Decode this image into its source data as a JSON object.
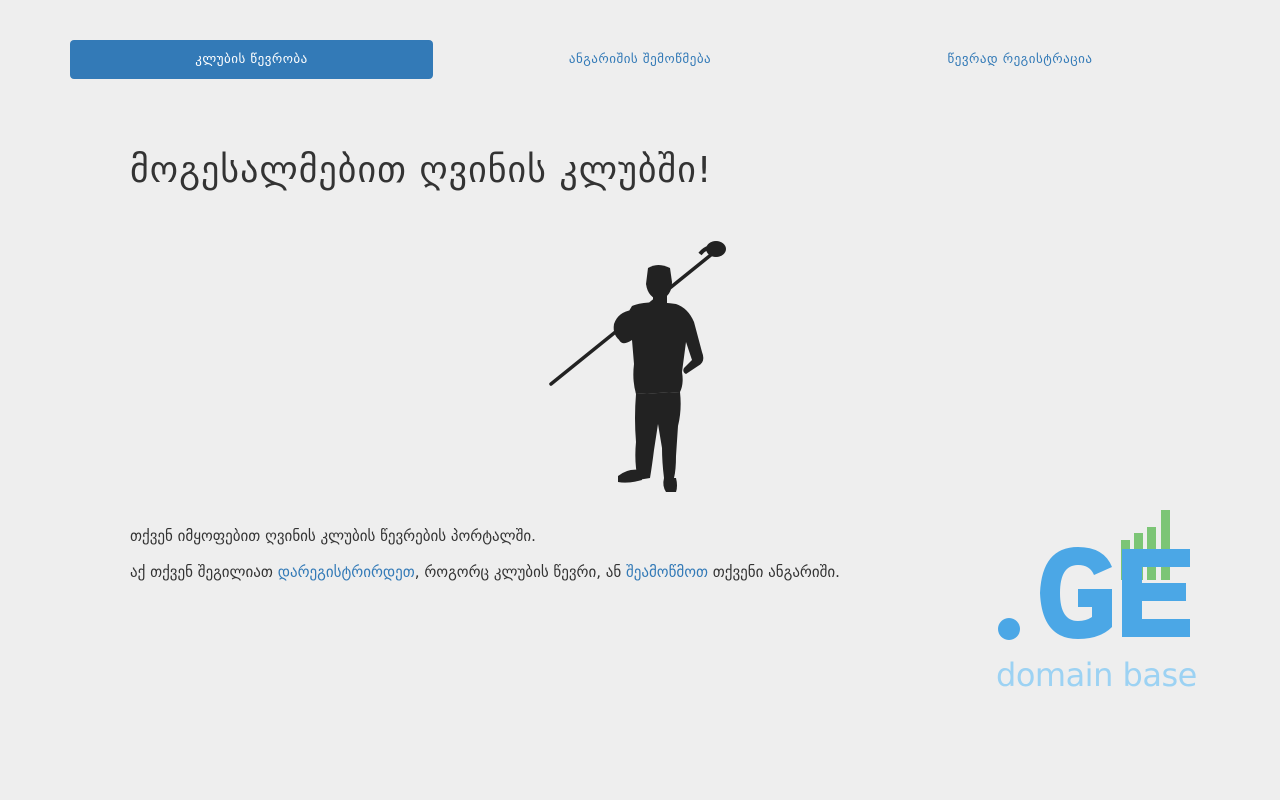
{
  "nav": {
    "items": [
      {
        "label": "კლუბის წევრობა",
        "active": true
      },
      {
        "label": "ანგარიშის შემოწმება",
        "active": false
      },
      {
        "label": "წევრად რეგისტრაცია",
        "active": false
      }
    ]
  },
  "main": {
    "title": "მოგესალმებით ღვინის კლუბში!",
    "silhouette_icon": "man-with-wine-corkscrew-silhouette",
    "paragraph1": "თქვენ იმყოფებით ღვინის კლუბის წევრების პორტალში.",
    "paragraph2": {
      "before": "აქ თქვენ შეგილიათ ",
      "link1": "დარეგისტრირდეთ",
      "middle": ", როგორც კლუბის წევრი, ან ",
      "link2": "შეამოწმოთ",
      "after": " თქვენი ანგარიში."
    }
  },
  "brand": {
    "logo_icon": "ge-domain-logo",
    "mark": ".GE",
    "subtitle": "domain base",
    "colors": {
      "blue": "#4ba7e6",
      "green": "#7cc576",
      "text": "#9cd2f3"
    }
  },
  "colors": {
    "accent": "#337ab7",
    "background": "#eeeeee",
    "text": "#333333"
  }
}
